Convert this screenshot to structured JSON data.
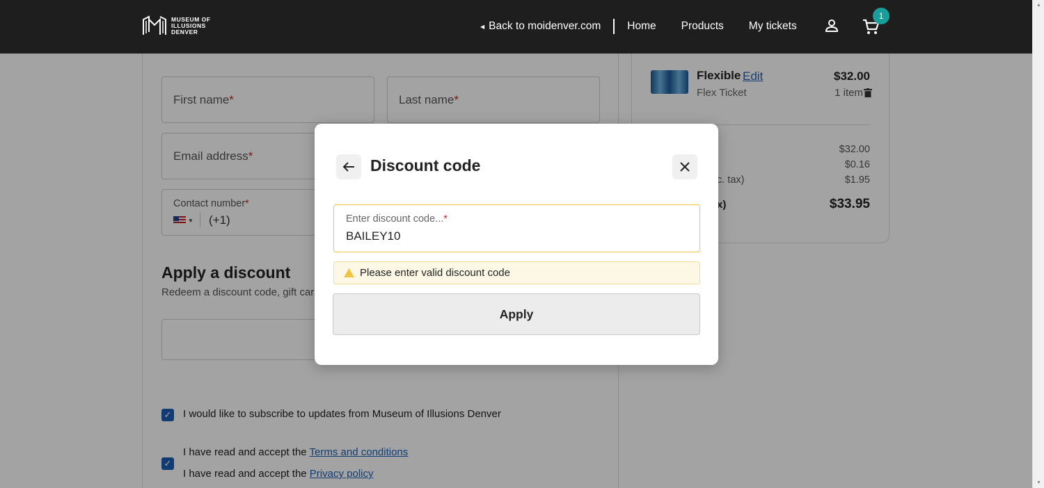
{
  "header": {
    "logo_lines": [
      "MUSEUM OF",
      "ILLUSIONS",
      "DENVER"
    ],
    "back_link": "Back to moidenver.com",
    "nav_items": [
      "Home",
      "Products",
      "My tickets"
    ],
    "cart_count": "1"
  },
  "form": {
    "first_name": "First name",
    "last_name": "Last name",
    "email": "Email address",
    "contact": "Contact number",
    "required_mark": "*",
    "dial_code": "(+1)"
  },
  "discount_section": {
    "title": "Apply a discount",
    "subtitle": "Redeem a discount code, gift car"
  },
  "consent": {
    "subscribe": "I would like to subscribe to updates from Museum of Illusions Denver",
    "terms_prefix": "I have read and accept the ",
    "terms_link": "Terms and conditions",
    "privacy_prefix": "I have read and accept the ",
    "privacy_link": "Privacy policy"
  },
  "cart": {
    "item_name": "Flexible",
    "edit_label": "Edit",
    "item_type": "Flex Ticket",
    "item_price": "$32.00",
    "item_qty": "1 item",
    "summary": [
      {
        "label": "",
        "value": "$32.00"
      },
      {
        "label": "",
        "value": "$0.16"
      },
      {
        "label": "c. tax)",
        "value": "$1.95"
      }
    ],
    "total_label": "x)",
    "total_value": "$33.95"
  },
  "modal": {
    "title": "Discount code",
    "field_label": "Enter discount code...",
    "required_mark": "*",
    "field_value": "BAILEY10",
    "warning": "Please enter valid discount code",
    "apply_label": "Apply"
  },
  "colors": {
    "accent": "#1a5fb4",
    "badge": "#1a9e9a",
    "warning_border": "#f0c440"
  }
}
